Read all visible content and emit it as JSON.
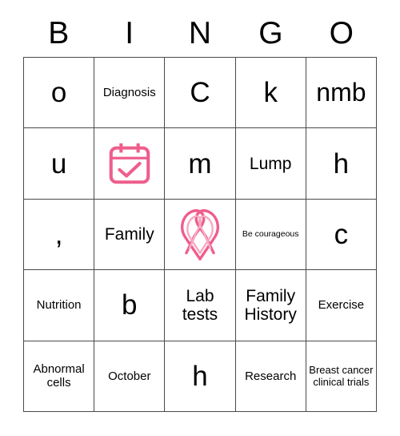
{
  "card": {
    "type": "bingo-card",
    "columns": [
      "B",
      "I",
      "N",
      "G",
      "O"
    ],
    "theme_color": "#ee5e8c",
    "grid_line_color": "#4a4a4a",
    "background_color": "#ffffff",
    "rows": [
      [
        {
          "kind": "text",
          "text": "o",
          "size": "xl"
        },
        {
          "kind": "text",
          "text": "Diagnosis",
          "size": "sm"
        },
        {
          "kind": "text",
          "text": "C",
          "size": "xl"
        },
        {
          "kind": "text",
          "text": "k",
          "size": "xl"
        },
        {
          "kind": "text",
          "text": "nmb",
          "size": "lg"
        }
      ],
      [
        {
          "kind": "text",
          "text": "u",
          "size": "xl"
        },
        {
          "kind": "icon",
          "icon": "calendar-check-icon",
          "text": ""
        },
        {
          "kind": "text",
          "text": "m",
          "size": "xl"
        },
        {
          "kind": "text",
          "text": "Lump",
          "size": "md"
        },
        {
          "kind": "text",
          "text": "h",
          "size": "xl"
        }
      ],
      [
        {
          "kind": "text",
          "text": ",",
          "size": "xl"
        },
        {
          "kind": "text",
          "text": "Family",
          "size": "md"
        },
        {
          "kind": "icon",
          "icon": "awareness-ribbon-icon",
          "text": ""
        },
        {
          "kind": "text",
          "text": "Be courageous",
          "size": "xxs"
        },
        {
          "kind": "text",
          "text": "c",
          "size": "xl"
        }
      ],
      [
        {
          "kind": "text",
          "text": "Nutrition",
          "size": "sm"
        },
        {
          "kind": "text",
          "text": "b",
          "size": "xl"
        },
        {
          "kind": "text",
          "text": "Lab tests",
          "size": "md"
        },
        {
          "kind": "text",
          "text": "Family History",
          "size": "md"
        },
        {
          "kind": "text",
          "text": "Exercise",
          "size": "sm"
        }
      ],
      [
        {
          "kind": "text",
          "text": "Abnormal cells",
          "size": "sm"
        },
        {
          "kind": "text",
          "text": "October",
          "size": "sm"
        },
        {
          "kind": "text",
          "text": "h",
          "size": "xl"
        },
        {
          "kind": "text",
          "text": "Research",
          "size": "sm"
        },
        {
          "kind": "text",
          "text": "Breast cancer clinical trials",
          "size": "xs"
        }
      ]
    ]
  }
}
